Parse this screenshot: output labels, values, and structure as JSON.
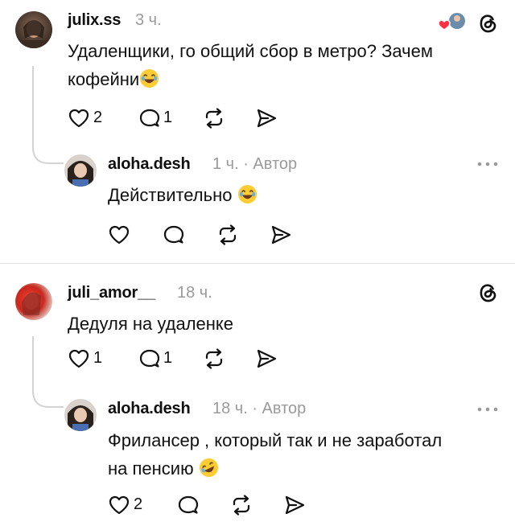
{
  "posts": [
    {
      "username": "julix.ss",
      "time": "3 ч.",
      "text": "Удаленщики, го общий сбор в метро? Зачем кофейни",
      "text_line1": "Удаленщики, го общий сбор в метро? Зачем",
      "text_line2": "кофейни",
      "likes": "2",
      "replies": "1",
      "reply": {
        "username": "aloha.desh",
        "meta": "1 ч. · Автор",
        "text": "Действительно",
        "likes": "",
        "replies": ""
      }
    },
    {
      "username": "juli_amor__",
      "time": "18 ч.",
      "text": "Дедуля на удаленке",
      "likes": "1",
      "replies": "1",
      "reply": {
        "username": "aloha.desh",
        "meta": "18 ч. · Автор",
        "text_line1": "Фрилансер , который так и не заработал",
        "text_line2": "на пенсию",
        "likes": "2",
        "replies": ""
      }
    }
  ],
  "icons": [
    "heart-icon",
    "comment-icon",
    "repost-icon",
    "share-icon",
    "threads-logo-icon",
    "more-icon",
    "emoji-laughing-icon",
    "emoji-rofl-icon"
  ],
  "colors": {
    "text": "#101010",
    "muted": "#9a9a9a",
    "line": "#d4d4d4",
    "heart_badge": "#ff3040"
  }
}
